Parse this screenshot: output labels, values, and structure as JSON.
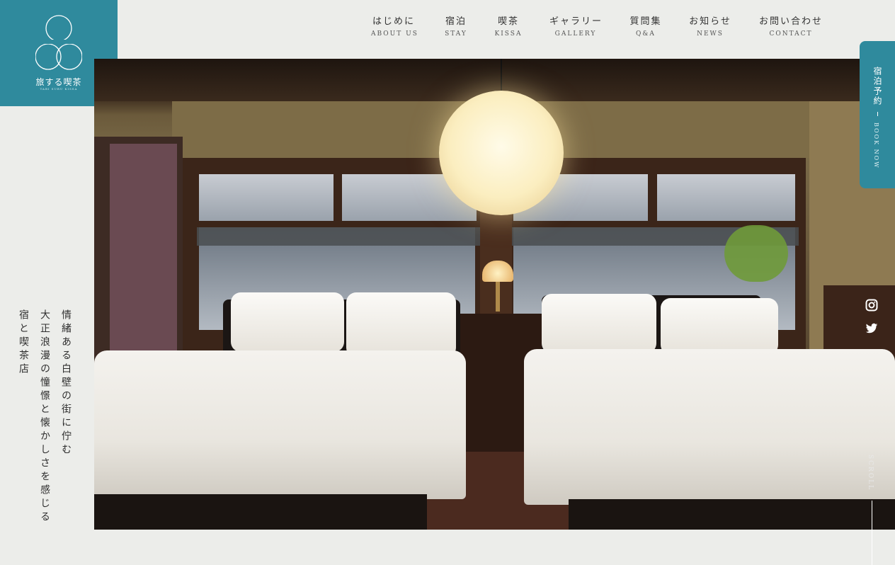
{
  "logo": {
    "name": "旅する喫茶",
    "subtitle": "TABI SURU KISSA",
    "background": "#2f8a9d"
  },
  "nav": {
    "items": [
      {
        "jp": "はじめに",
        "en": "ABOUT US"
      },
      {
        "jp": "宿泊",
        "en": "STAY"
      },
      {
        "jp": "喫茶",
        "en": "KISSA"
      },
      {
        "jp": "ギャラリー",
        "en": "GALLERY"
      },
      {
        "jp": "質問集",
        "en": "Q&A"
      },
      {
        "jp": "お知らせ",
        "en": "NEWS"
      },
      {
        "jp": "お問い合わせ",
        "en": "CONTACT"
      }
    ]
  },
  "hero": {
    "copy": [
      "情緒ある白壁の街に佇む",
      "大正浪漫の憧憬と懐かしさを感じる",
      "宿と喫茶店"
    ]
  },
  "book": {
    "jp": "宿泊予約",
    "en": "BOOK NOW",
    "color": "#2f8a9d"
  },
  "social": {
    "icons": [
      "instagram-icon",
      "twitter-icon"
    ]
  },
  "scroll": {
    "label": "SCROLL"
  },
  "colors": {
    "accent": "#2f8a9d",
    "page_background": "#ecedea"
  }
}
